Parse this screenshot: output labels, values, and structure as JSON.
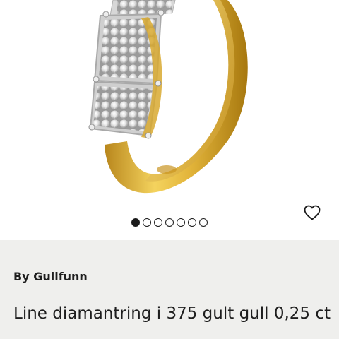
{
  "gallery": {
    "image_alt": "Line diamantring i 375 gult gull",
    "image_count": 7,
    "active_index": 0,
    "favorite_icon": "heart-outline-icon"
  },
  "product": {
    "brand": "By Gullfunn",
    "title": "Line diamantring i 375 gult gull 0,25 ct"
  },
  "colors": {
    "info_background": "#efefed",
    "text": "#1e1e1e",
    "gold": "#e2b43a"
  }
}
